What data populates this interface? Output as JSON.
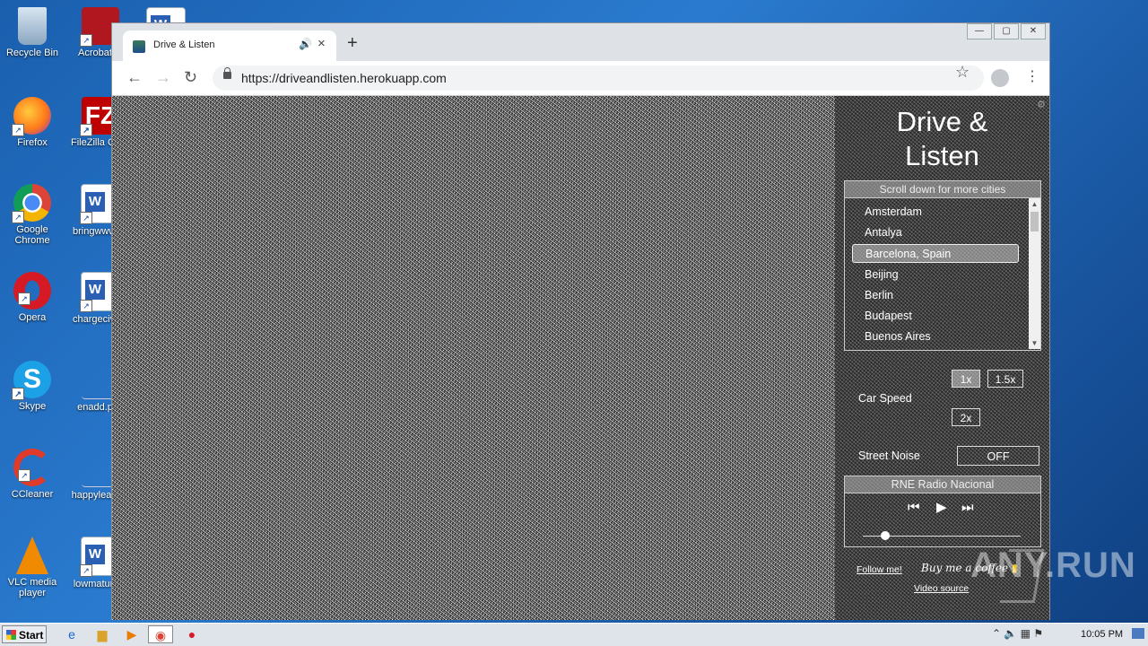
{
  "desktop": {
    "icons": [
      {
        "label": "Recycle Bin"
      },
      {
        "label": "Acrobat Reader"
      },
      {
        "label": "Firefox"
      },
      {
        "label": "FileZilla Client"
      },
      {
        "label": "Google Chrome"
      },
      {
        "label": "bringwww"
      },
      {
        "label": "Opera"
      },
      {
        "label": "chargeciv"
      },
      {
        "label": "Skype"
      },
      {
        "label": "enadd.p"
      },
      {
        "label": "CCleaner"
      },
      {
        "label": "happylea"
      },
      {
        "label": "VLC media player"
      },
      {
        "label": "lowmatur"
      }
    ]
  },
  "browser": {
    "tab_title": "Drive & Listen",
    "tab_audio_icon": "speaker-icon",
    "new_tab": "+",
    "url": "https://driveandlisten.herokuapp.com",
    "window_controls": [
      "—",
      "▢",
      "✕"
    ]
  },
  "app": {
    "title_line1": "Drive &",
    "title_line2": "Listen",
    "city_header": "Scroll down for more cities",
    "cities": [
      "Amsterdam",
      "Antalya",
      "Barcelona, Spain",
      "Beijing",
      "Berlin",
      "Budapest",
      "Buenos Aires"
    ],
    "selected_city": "Barcelona, Spain",
    "car_speed_label": "Car Speed",
    "speed_options": [
      "1x",
      "1.5x",
      "2x"
    ],
    "selected_speed": "1x",
    "street_noise_label": "Street Noise",
    "street_noise_value": "OFF",
    "radio_station": "RNE Radio Nacional",
    "radio_controls": {
      "prev": "⏮",
      "play": "▶",
      "next": "⏭"
    },
    "volume_fraction": 0.14,
    "follow_me": "Follow me!",
    "coffee": "Buy me a coffee",
    "video_source": "Video source"
  },
  "watermark": "ANY.RUN",
  "taskbar": {
    "start_label": "Start",
    "time": "10:05 PM"
  }
}
